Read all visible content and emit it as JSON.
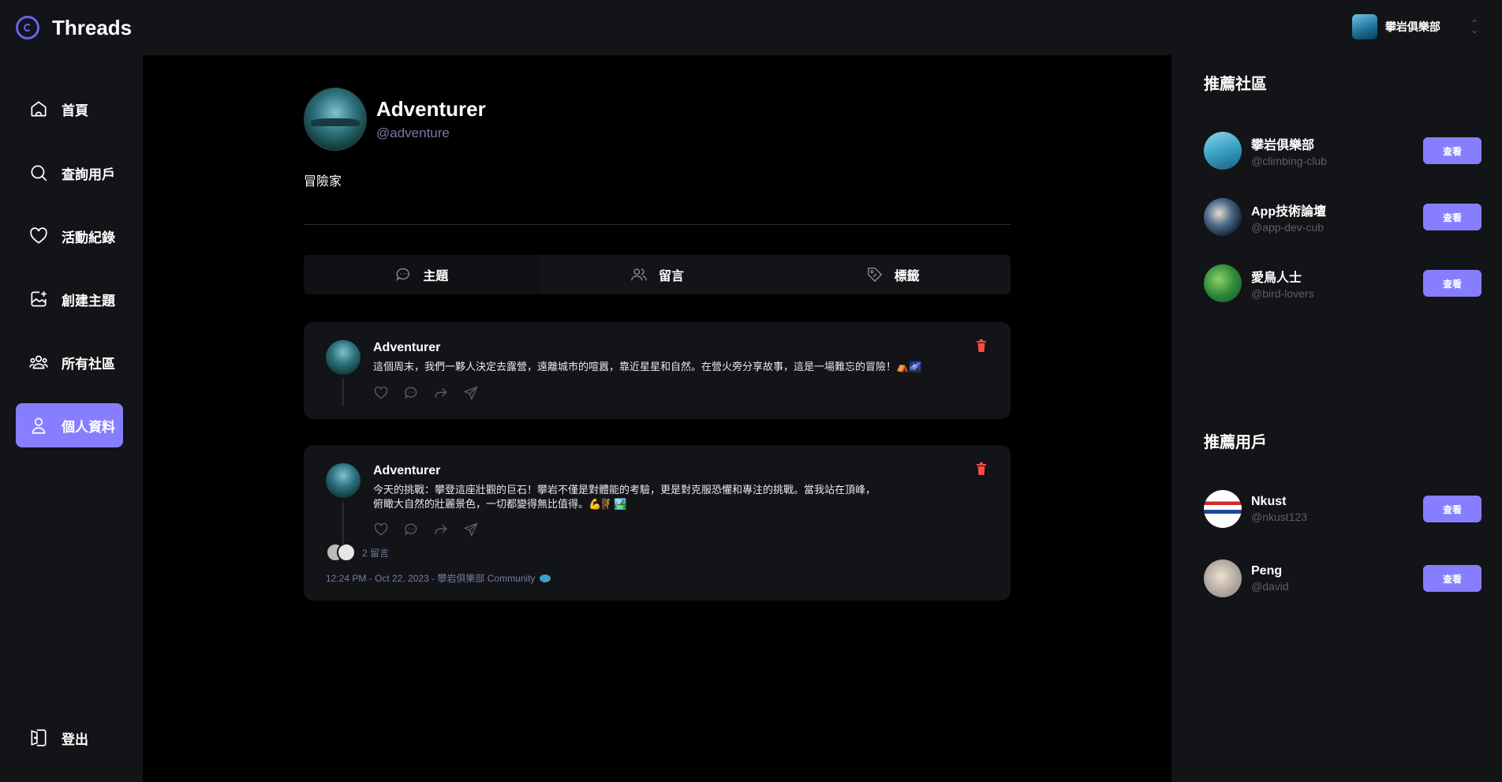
{
  "app": {
    "title": "Threads"
  },
  "org": {
    "name": "攀岩俱樂部"
  },
  "nav": {
    "items": [
      {
        "label": "首頁",
        "icon": "home-icon"
      },
      {
        "label": "查詢用戶",
        "icon": "search-icon"
      },
      {
        "label": "活動紀錄",
        "icon": "heart-icon"
      },
      {
        "label": "創建主題",
        "icon": "create-icon"
      },
      {
        "label": "所有社區",
        "icon": "community-icon"
      },
      {
        "label": "個人資料",
        "icon": "user-icon",
        "active": true
      }
    ],
    "logout": "登出"
  },
  "profile": {
    "name": "Adventurer",
    "handle": "@adventure",
    "bio": "冒險家"
  },
  "tabs": [
    {
      "label": "主題",
      "icon": "chat-icon"
    },
    {
      "label": "留言",
      "icon": "users-icon"
    },
    {
      "label": "標籤",
      "icon": "tag-icon"
    }
  ],
  "posts": [
    {
      "author": "Adventurer",
      "text": "這個周末，我們一夥人決定去露營，遠離城市的喧囂，靠近星星和自然。在營火旁分享故事，這是一場難忘的冒險！⛺🌌"
    },
    {
      "author": "Adventurer",
      "text": "今天的挑戰：攀登這座壯觀的巨石！攀岩不僅是對體能的考驗，更是對克服恐懼和專注的挑戰。當我站在頂峰，俯瞰大自然的壯麗景色，一切都變得無比值得。💪🧗🏞️",
      "replies": "2 留言",
      "meta": "12:24 PM - Oct 22, 2023 - 攀岩俱樂部 Community"
    }
  ],
  "right": {
    "communities_title": "推薦社區",
    "communities": [
      {
        "name": "攀岩俱樂部",
        "handle": "@climbing-club",
        "button": "查看"
      },
      {
        "name": "App技術論壇",
        "handle": "@app-dev-cub",
        "button": "查看"
      },
      {
        "name": "愛鳥人士",
        "handle": "@bird-lovers",
        "button": "查看"
      }
    ],
    "users_title": "推薦用戶",
    "users": [
      {
        "name": "Nkust",
        "handle": "@nkust123",
        "button": "查看"
      },
      {
        "name": "Peng",
        "handle": "@david",
        "button": "查看"
      }
    ]
  },
  "colors": {
    "accent": "#877eff",
    "danger": "#ff4a4a",
    "background": "#000000",
    "panel": "#121417"
  }
}
